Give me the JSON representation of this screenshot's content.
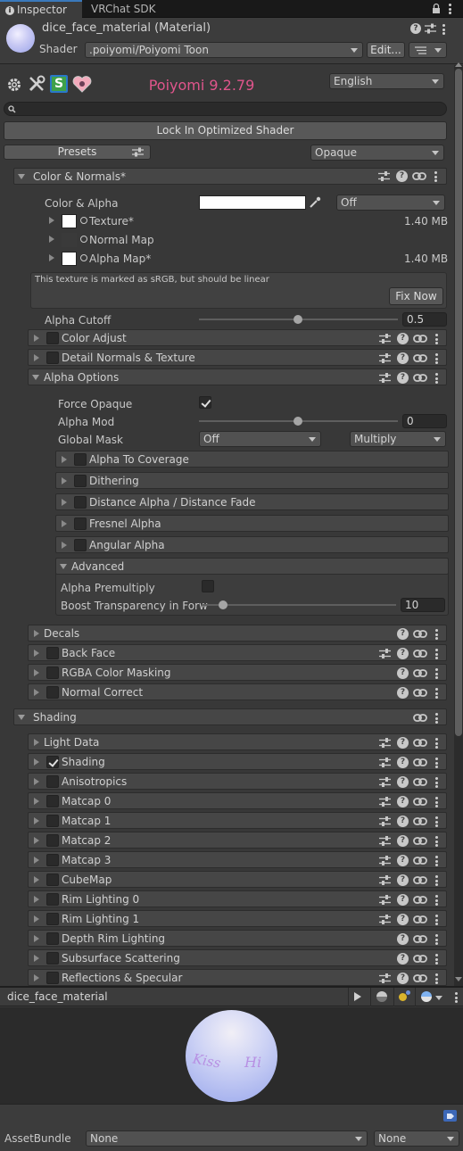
{
  "tabs": [
    {
      "label": "Inspector"
    },
    {
      "label": "VRChat SDK"
    }
  ],
  "material": {
    "name": "dice_face_material (Material)",
    "shader_label": "Shader",
    "shader_value": ".poiyomi/Poiyomi Toon",
    "edit_label": "Edit..."
  },
  "toolbar": {
    "title": "Poiyomi 9.2.79",
    "title_color": "#e0558c",
    "language": "English",
    "search_placeholder": ""
  },
  "lock_button": "Lock In Optimized Shader",
  "presets_label": "Presets",
  "render_mode": "Opaque",
  "color_normals": {
    "header": "Color & Normals*",
    "color_alpha_label": "Color & Alpha",
    "color_alpha_mode": "Off",
    "textures": [
      {
        "label": "Texture*",
        "size": "1.40 MB"
      },
      {
        "label": "Normal Map",
        "size": ""
      },
      {
        "label": "Alpha Map*",
        "size": "1.40 MB"
      }
    ],
    "warning": "This texture is marked as sRGB, but should be linear",
    "fix_now": "Fix Now",
    "alpha_cutoff_label": "Alpha Cutoff",
    "alpha_cutoff_value": "0.5"
  },
  "sub_sections_1": [
    {
      "label": "Color Adjust"
    },
    {
      "label": "Detail Normals & Texture"
    }
  ],
  "alpha_options": {
    "header": "Alpha Options",
    "force_opaque_label": "Force Opaque",
    "alpha_mod_label": "Alpha Mod",
    "alpha_mod_value": "0",
    "global_mask_label": "Global Mask",
    "global_mask_value": "Off",
    "global_mask_blend": "Multiply",
    "subs": [
      {
        "label": "Alpha To Coverage"
      },
      {
        "label": "Dithering"
      },
      {
        "label": "Distance Alpha / Distance Fade"
      },
      {
        "label": "Fresnel Alpha"
      },
      {
        "label": "Angular Alpha"
      }
    ],
    "advanced_header": "Advanced",
    "alpha_premultiply_label": "Alpha Premultiply",
    "boost_label": "Boost Transparency in Forw",
    "boost_value": "10"
  },
  "sub_sections_2": [
    {
      "label": "Decals"
    },
    {
      "label": "Back Face"
    },
    {
      "label": "RGBA Color Masking"
    },
    {
      "label": "Normal Correct"
    }
  ],
  "shading_header": "Shading",
  "shading_sections": [
    {
      "label": "Light Data"
    },
    {
      "label": "Shading"
    },
    {
      "label": "Anisotropics"
    },
    {
      "label": "Matcap 0"
    },
    {
      "label": "Matcap 1"
    },
    {
      "label": "Matcap 2"
    },
    {
      "label": "Matcap 3"
    },
    {
      "label": "CubeMap"
    },
    {
      "label": "Rim Lighting 0"
    },
    {
      "label": "Rim Lighting 1"
    },
    {
      "label": "Depth Rim Lighting"
    },
    {
      "label": "Subsurface Scattering"
    },
    {
      "label": "Reflections & Specular"
    }
  ],
  "preview": {
    "title": "dice_face_material",
    "sphere_text_left": "Kiss",
    "sphere_text_right": "Hi"
  },
  "assetbundle": {
    "label": "AssetBundle",
    "name_value": "None",
    "variant_value": "None"
  }
}
